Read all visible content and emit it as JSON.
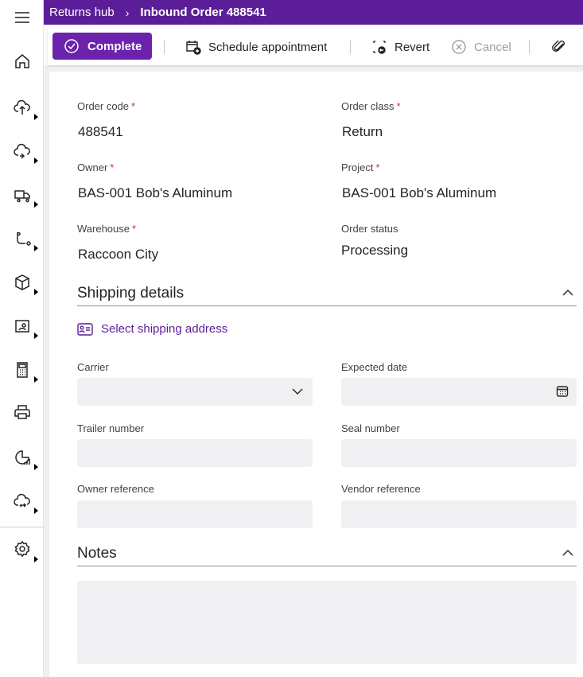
{
  "breadcrumb": {
    "parent": "Returns hub",
    "separator": "›",
    "current": "Inbound Order 488541"
  },
  "toolbar": {
    "complete": "Complete",
    "schedule": "Schedule appointment",
    "revert": "Revert",
    "cancel": "Cancel"
  },
  "form": {
    "order_code": {
      "label": "Order code",
      "value": "488541",
      "required_mark": "*"
    },
    "order_class": {
      "label": "Order class",
      "value": "Return",
      "required_mark": "*"
    },
    "owner": {
      "label": "Owner",
      "value": "BAS-001 Bob's Aluminum",
      "required_mark": "*"
    },
    "project": {
      "label": "Project",
      "value": "BAS-001 Bob's Aluminum",
      "required_mark": "*"
    },
    "warehouse": {
      "label": "Warehouse",
      "value": "Raccoon City",
      "required_mark": "*"
    },
    "order_status": {
      "label": "Order status",
      "value": "Processing"
    }
  },
  "shipping": {
    "title": "Shipping details",
    "select_address": "Select shipping address",
    "carrier_label": "Carrier",
    "expected_date_label": "Expected date",
    "trailer_label": "Trailer number",
    "seal_label": "Seal number",
    "owner_ref_label": "Owner reference",
    "vendor_ref_label": "Vendor reference"
  },
  "notes": {
    "title": "Notes"
  },
  "colors": {
    "brand": "#5c1d99",
    "primary_button": "#6b22ad",
    "required": "#c4314b",
    "field_bg": "#f0eff2"
  }
}
